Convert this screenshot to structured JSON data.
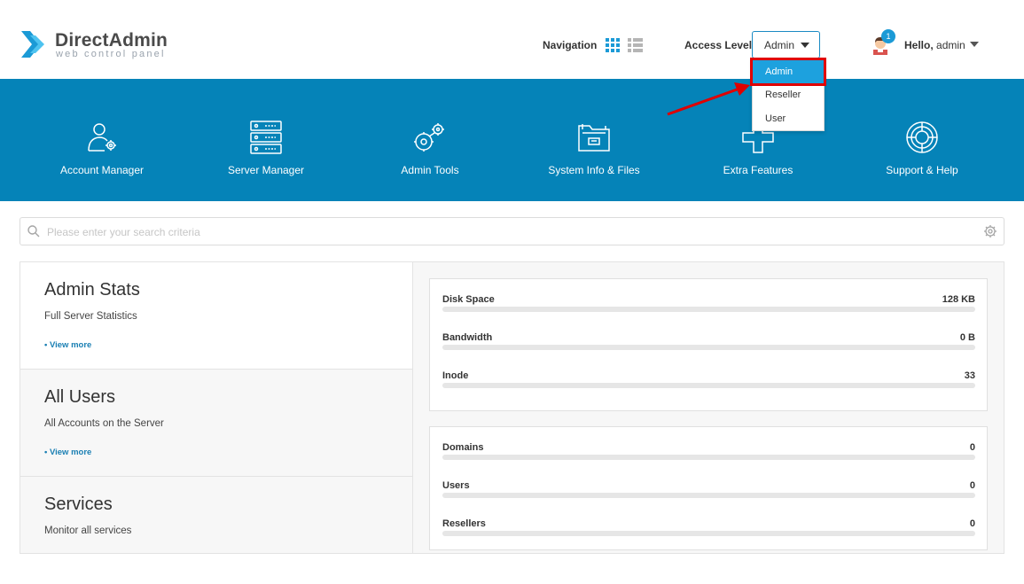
{
  "logo": {
    "title": "DirectAdmin",
    "subtitle": "web control panel"
  },
  "header": {
    "navigation_label": "Navigation",
    "access_level_label": "Access Level",
    "access_level_value": "Admin",
    "notification_count": "1",
    "greeting": "Hello,",
    "username": "admin"
  },
  "access_dropdown": {
    "options": [
      {
        "label": "Admin",
        "selected": true
      },
      {
        "label": "Reseller",
        "selected": false
      },
      {
        "label": "User",
        "selected": false
      }
    ]
  },
  "main_menu": {
    "items": [
      {
        "label": "Account Manager",
        "icon": "account-manager-icon"
      },
      {
        "label": "Server Manager",
        "icon": "server-icon"
      },
      {
        "label": "Admin Tools",
        "icon": "admin-tools-icon"
      },
      {
        "label": "System Info & Files",
        "icon": "folder-icon"
      },
      {
        "label": "Extra Features",
        "icon": "plus-icon"
      },
      {
        "label": "Support & Help",
        "icon": "lifebuoy-icon"
      }
    ]
  },
  "search": {
    "placeholder": "Please enter your search criteria"
  },
  "cards": [
    {
      "title": "Admin Stats",
      "subtitle": "Full Server Statistics",
      "link": "• View more"
    },
    {
      "title": "All Users",
      "subtitle": "All Accounts on the Server",
      "link": "• View more"
    },
    {
      "title": "Services",
      "subtitle": "Monitor all services",
      "link": ""
    }
  ],
  "usage_stats": [
    {
      "name": "Disk Space",
      "value": "128 KB",
      "fraction": 0
    },
    {
      "name": "Bandwidth",
      "value": "0 B",
      "fraction": 0
    },
    {
      "name": "Inode",
      "value": "33",
      "fraction": 0
    }
  ],
  "count_stats": [
    {
      "name": "Domains",
      "value": "0",
      "fraction": 0
    },
    {
      "name": "Users",
      "value": "0",
      "fraction": 0
    },
    {
      "name": "Resellers",
      "value": "0",
      "fraction": 0
    }
  ],
  "colors": {
    "accent": "#0583b8",
    "highlight": "#e00000",
    "dropdown_active": "#1da1de"
  }
}
